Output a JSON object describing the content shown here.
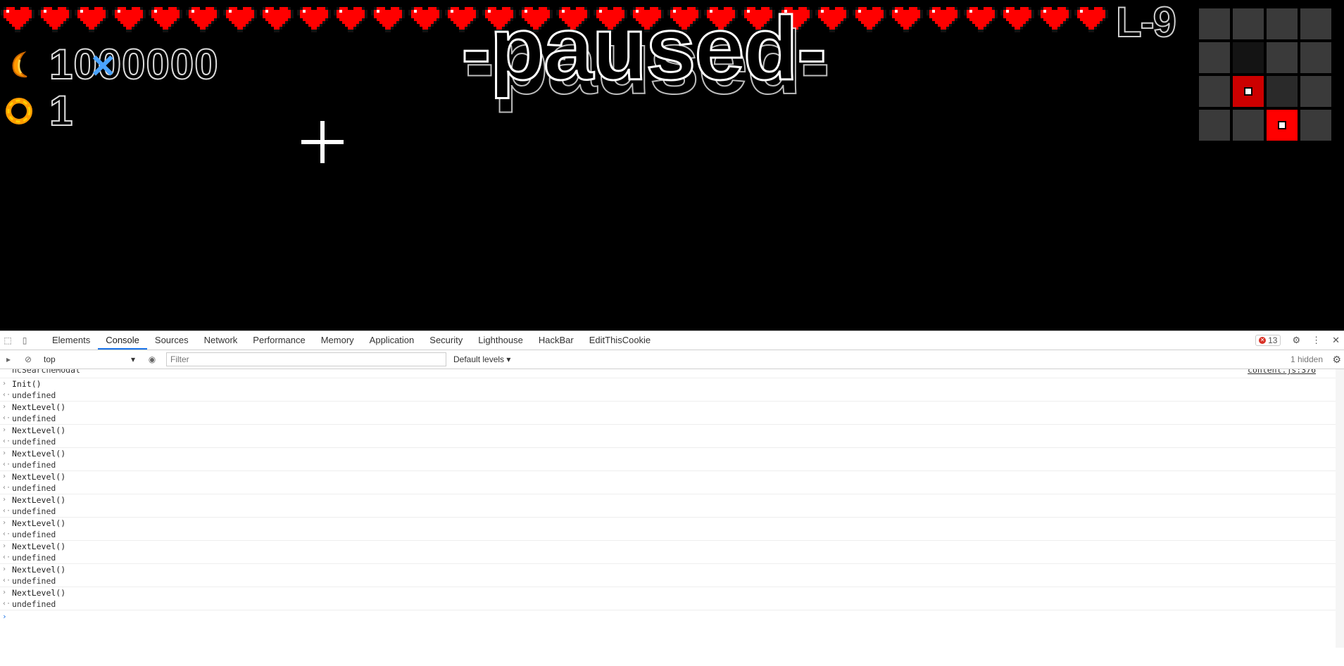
{
  "game": {
    "hearts_count": 30,
    "level_label": "L-9",
    "paused_text": "-paused-",
    "score_value": "1000000",
    "coins_value": "1",
    "icons": {
      "score": "crescent-moon-icon",
      "coins": "gold-ring-icon",
      "cursor": "crosshair-icon",
      "heart": "pixel-heart-icon"
    },
    "minimap": [
      [
        "light",
        "light",
        "light",
        "light"
      ],
      [
        "light",
        "dark",
        "light",
        "light"
      ],
      [
        "light",
        "red-room",
        "mid",
        "light"
      ],
      [
        "light",
        "light",
        "current-room",
        "light"
      ]
    ],
    "colors": {
      "heart": "#ff0000",
      "room_visited": "#cc0000",
      "room_current": "#ff0000"
    }
  },
  "devtools": {
    "tabs": [
      "Elements",
      "Console",
      "Sources",
      "Network",
      "Performance",
      "Memory",
      "Application",
      "Security",
      "Lighthouse",
      "HackBar",
      "EditThisCookie"
    ],
    "active_tab": "Console",
    "error_count": "13",
    "toolbar": {
      "context": "top",
      "filter_placeholder": "Filter",
      "levels": "Default levels ▾",
      "hidden": "1 hidden"
    },
    "console": {
      "cutoff_text": "ncSearcheModal",
      "cutoff_link": "content.js:376",
      "entries": [
        {
          "input": "Init()",
          "output": "undefined"
        },
        {
          "input": "NextLevel()",
          "output": "undefined"
        },
        {
          "input": "NextLevel()",
          "output": "undefined"
        },
        {
          "input": "NextLevel()",
          "output": "undefined"
        },
        {
          "input": "NextLevel()",
          "output": "undefined"
        },
        {
          "input": "NextLevel()",
          "output": "undefined"
        },
        {
          "input": "NextLevel()",
          "output": "undefined"
        },
        {
          "input": "NextLevel()",
          "output": "undefined"
        },
        {
          "input": "NextLevel()",
          "output": "undefined"
        },
        {
          "input": "NextLevel()",
          "output": "undefined"
        }
      ]
    }
  }
}
